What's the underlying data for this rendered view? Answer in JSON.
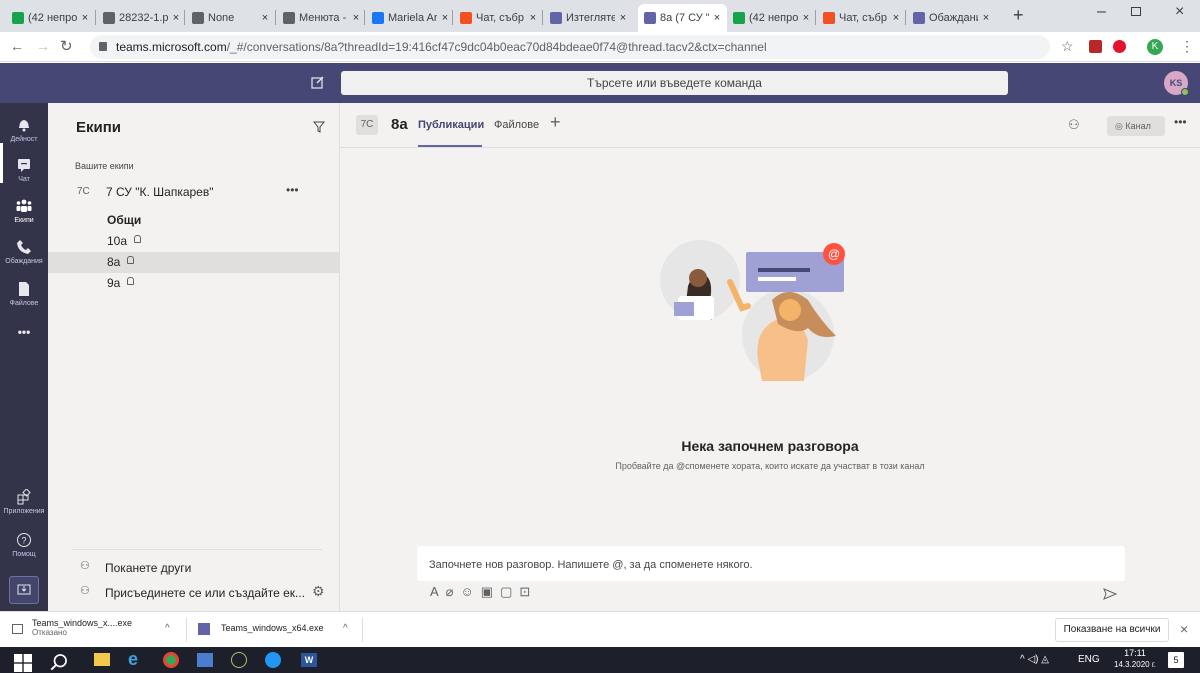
{
  "browser": {
    "tabs": [
      {
        "title": "(42 непро",
        "icon": "notification-house-icon"
      },
      {
        "title": "28232-1.p",
        "icon": "globe-icon"
      },
      {
        "title": "None",
        "icon": "globe-icon"
      },
      {
        "title": "Менюта -",
        "icon": "globe-icon"
      },
      {
        "title": "Mariela Ar",
        "icon": "facebook-icon"
      },
      {
        "title": "Чат, събр",
        "icon": "microsoft-icon"
      },
      {
        "title": "Изтегляте",
        "icon": "teams-icon"
      },
      {
        "title": "8a (7 СУ \"К",
        "icon": "teams-icon"
      },
      {
        "title": "(42 непро",
        "icon": "notification-house-icon"
      },
      {
        "title": "Чат, събр",
        "icon": "microsoft-icon"
      },
      {
        "title": "Обаждани",
        "icon": "teams-icon"
      }
    ],
    "active_tab": 7,
    "url_host": "teams.microsoft.com",
    "url_path": "/_#/conversations/8a?threadId=19:416cf47c9dc04b0eac70d84bdeae0f74@thread.tacv2&ctx=channel",
    "profile_initial": "K"
  },
  "teams": {
    "search_placeholder": "Търсете или въведете команда",
    "user_initials": "KS",
    "rail": [
      {
        "label": "Дейност",
        "icon": "bell-icon"
      },
      {
        "label": "Чат",
        "icon": "chat-icon"
      },
      {
        "label": "Екипи",
        "icon": "teams-people-icon"
      },
      {
        "label": "Обаждания",
        "icon": "phone-icon"
      },
      {
        "label": "Файлове",
        "icon": "file-icon"
      }
    ],
    "rail_more": "•••",
    "rail_bottom": [
      {
        "label": "Приложения",
        "icon": "apps-icon"
      },
      {
        "label": "Помощ",
        "icon": "help-icon"
      }
    ],
    "panel": {
      "title": "Екипи",
      "section": "Вашите екипи",
      "team_badge": "7С",
      "team_name": "7 СУ \"К. Шапкарев\"",
      "channels": [
        {
          "name": "Общи",
          "bold": true,
          "locked": false
        },
        {
          "name": "10a",
          "bold": false,
          "locked": true
        },
        {
          "name": "8a",
          "bold": false,
          "locked": true,
          "selected": true
        },
        {
          "name": "9a",
          "bold": false,
          "locked": true
        }
      ],
      "invite": "Поканете други",
      "join": "Присъединете се или създайте ек..."
    },
    "channel": {
      "badge": "7С",
      "name": "8a",
      "tabs": [
        "Публикации",
        "Файлове"
      ],
      "add_tab": "+",
      "channel_btn": "Канал",
      "more": "•••"
    },
    "empty": {
      "title": "Нека започнем разговора",
      "subtitle": "Пробвайте да @споменете хората, които искате да участват в този канал"
    },
    "compose_placeholder": "Започнете нов разговор. Напишете @, за да споменете някого."
  },
  "downloads": {
    "items": [
      {
        "name": "Teams_windows_x....exe",
        "status": "Отказано"
      },
      {
        "name": "Teams_windows_x64.exe",
        "status": ""
      }
    ],
    "show_all": "Показване на всички",
    "close": "×"
  },
  "taskbar": {
    "lang": "ENG",
    "time": "17:11",
    "date": "14.3.2020 г.",
    "notif_count": "5"
  },
  "colors": {
    "teams_purple": "#6264a7",
    "teams_dark": "#464775",
    "rail": "#33344a",
    "accent_red": "#ff5240"
  }
}
